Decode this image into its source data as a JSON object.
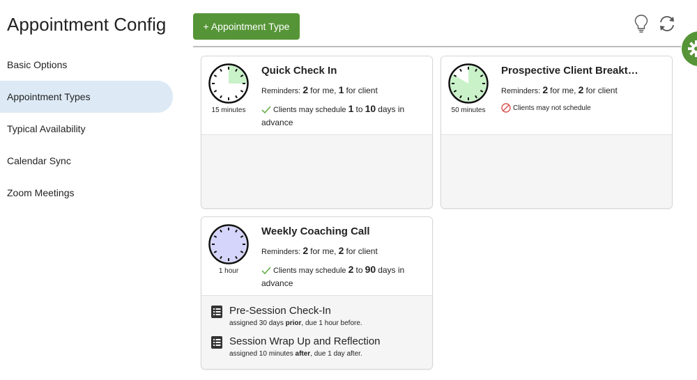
{
  "page": {
    "title": "Appointment Config"
  },
  "sidebar": {
    "items": [
      {
        "label": "Basic Options",
        "active": false
      },
      {
        "label": "Appointment Types",
        "active": true
      },
      {
        "label": "Typical Availability",
        "active": false
      },
      {
        "label": "Calendar Sync",
        "active": false
      },
      {
        "label": "Zoom Meetings",
        "active": false
      }
    ]
  },
  "toolbar": {
    "add_label": "+ Appointment Type",
    "accent_color": "#569537",
    "icons": [
      "lightbulb-icon",
      "refresh-icon",
      "gear-icon"
    ]
  },
  "cards": [
    {
      "title": "Quick Check In",
      "duration": "15 minutes",
      "duration_fraction": 0.25,
      "clock_fill": "#c9f2c9",
      "reminders_prefix": "Reminders:",
      "reminders_me_count": "2",
      "reminders_me_text": "for me,",
      "reminders_client_count": "1",
      "reminders_client_text": "for client",
      "schedule": {
        "allowed": true,
        "prefix": "Clients may schedule",
        "min": "1",
        "to": "to",
        "max": "10",
        "suffix": "days in",
        "suffix2": "advance"
      },
      "forms": []
    },
    {
      "title": "Prospective Client Breakt…",
      "duration": "50 minutes",
      "duration_fraction": 0.8333,
      "clock_fill": "#c9f2c9",
      "reminders_prefix": "Reminders:",
      "reminders_me_count": "2",
      "reminders_me_text": "for me,",
      "reminders_client_count": "2",
      "reminders_client_text": "for client",
      "schedule": {
        "allowed": false,
        "text": "Clients may not schedule"
      },
      "forms": []
    },
    {
      "title": "Weekly Coaching Call",
      "duration": "1 hour",
      "duration_fraction": 1.0,
      "clock_fill": "#d5d5fb",
      "reminders_prefix": "Reminders:",
      "reminders_me_count": "2",
      "reminders_me_text": "for me,",
      "reminders_client_count": "2",
      "reminders_client_text": "for client",
      "schedule": {
        "allowed": true,
        "prefix": "Clients may schedule",
        "min": "2",
        "to": "to",
        "max": "90",
        "suffix": "days in",
        "suffix2": "advance"
      },
      "forms": [
        {
          "title": "Pre-Session Check-In",
          "desc_a": "assigned 30 days ",
          "desc_bold": "prior",
          "desc_b": ", due 1 hour before."
        },
        {
          "title": "Session Wrap Up and Reflection",
          "desc_a": "assigned 10 minutes ",
          "desc_bold": "after",
          "desc_b": ", due 1 day after."
        }
      ]
    }
  ]
}
